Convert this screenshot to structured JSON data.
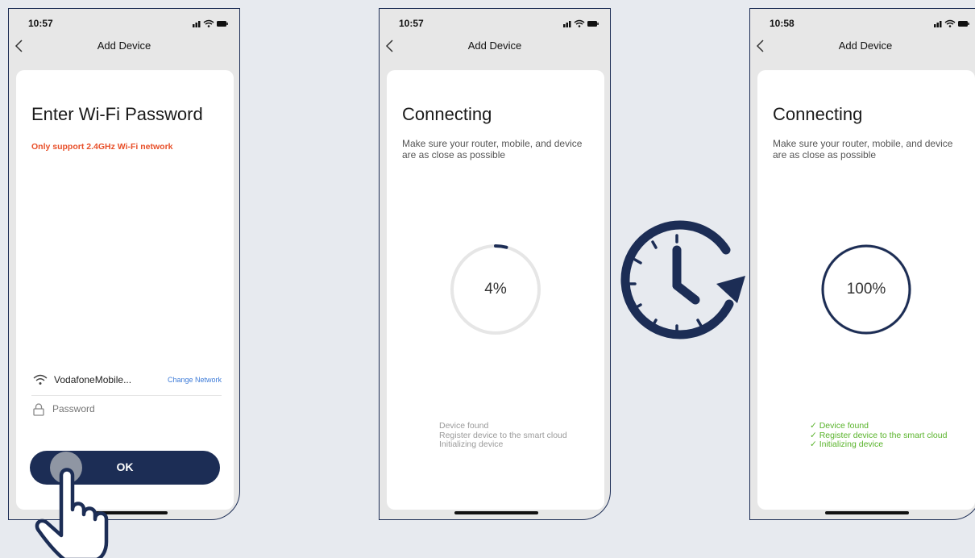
{
  "screens": [
    {
      "time": "10:57",
      "header_title": "Add Device",
      "title": "Enter Wi-Fi Password",
      "warning": "Only support 2.4GHz Wi-Fi network",
      "network_name": "VodafoneMobile...",
      "change_network": "Change Network",
      "password_placeholder": "Password",
      "ok_label": "OK"
    },
    {
      "time": "10:57",
      "header_title": "Add Device",
      "title": "Connecting",
      "description": "Make sure your router, mobile, and device are as close as possible",
      "progress": "4%",
      "progress_value": 4,
      "steps": [
        "Device found",
        "Register device to the smart cloud",
        "Initializing device"
      ]
    },
    {
      "time": "10:58",
      "header_title": "Add Device",
      "title": "Connecting",
      "description": "Make sure your router, mobile, and device are as close as possible",
      "progress": "100%",
      "progress_value": 100,
      "steps": [
        "✓ Device found",
        "✓ Register device to the smart cloud",
        "✓ Initializing device"
      ]
    }
  ],
  "colors": {
    "navy": "#1c2d55",
    "warning": "#e8502a",
    "link": "#3d7bd8",
    "success": "#58b32a",
    "step_gray": "#9a9a9a",
    "ring_track": "#e6e6e6"
  },
  "decorations": {
    "tap_hand": "hand-pointer-icon",
    "wait_clock": "clock-refresh-icon"
  }
}
